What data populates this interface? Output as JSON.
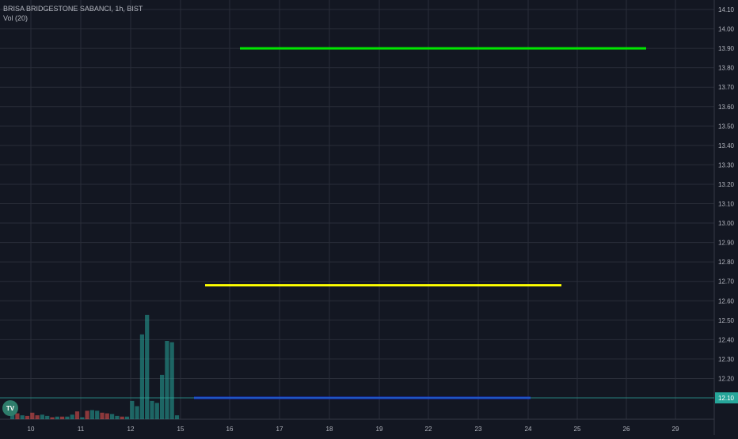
{
  "header": {
    "title": "BRISA BRIDGESTONE SABANCI, 1h, BIST",
    "indicator": "Vol (20)"
  },
  "logo": {
    "text": "TV",
    "color": "#2e7d6b"
  },
  "colors": {
    "background": "#131722",
    "grid": "#2a2e39",
    "axis_text": "#b2b5be",
    "up_volume": "#26a69a",
    "down_volume": "#ef5350",
    "price_marker_bg": "#26a69a",
    "price_marker_line": "#26a69a"
  },
  "chart_data": {
    "type": "bar",
    "x_ticks": [
      "10",
      "11",
      "12",
      "15",
      "16",
      "17",
      "18",
      "19",
      "22",
      "23",
      "24",
      "25",
      "26",
      "29"
    ],
    "y_ticks": [
      "14.10",
      "14.00",
      "13.90",
      "13.80",
      "13.70",
      "13.60",
      "13.50",
      "13.40",
      "13.30",
      "13.20",
      "13.10",
      "13.00",
      "12.90",
      "12.80",
      "12.70",
      "12.60",
      "12.50",
      "12.40",
      "12.30",
      "12.20",
      "12.10"
    ],
    "ylim": [
      12.0,
      14.15
    ],
    "last_price": "12.10",
    "volume_bars": [
      {
        "x": "10",
        "v": 7,
        "dir": "up"
      },
      {
        "x": "10",
        "v": 9,
        "dir": "down"
      },
      {
        "x": "10",
        "v": 6,
        "dir": "up"
      },
      {
        "x": "10",
        "v": 5,
        "dir": "down"
      },
      {
        "x": "10",
        "v": 10,
        "dir": "down"
      },
      {
        "x": "10",
        "v": 6,
        "dir": "down"
      },
      {
        "x": "10",
        "v": 7,
        "dir": "up"
      },
      {
        "x": "10",
        "v": 5,
        "dir": "up"
      },
      {
        "x": "11",
        "v": 3,
        "dir": "down"
      },
      {
        "x": "11",
        "v": 4,
        "dir": "up"
      },
      {
        "x": "11",
        "v": 4,
        "dir": "down"
      },
      {
        "x": "11",
        "v": 4,
        "dir": "up"
      },
      {
        "x": "11",
        "v": 7,
        "dir": "up"
      },
      {
        "x": "11",
        "v": 12,
        "dir": "down"
      },
      {
        "x": "11",
        "v": 3,
        "dir": "up"
      },
      {
        "x": "11",
        "v": 13,
        "dir": "down"
      },
      {
        "x": "11",
        "v": 14,
        "dir": "up"
      },
      {
        "x": "11",
        "v": 13,
        "dir": "up"
      },
      {
        "x": "11",
        "v": 10,
        "dir": "down"
      },
      {
        "x": "11",
        "v": 9,
        "dir": "down"
      },
      {
        "x": "11",
        "v": 8,
        "dir": "up"
      },
      {
        "x": "11",
        "v": 5,
        "dir": "up"
      },
      {
        "x": "12",
        "v": 4,
        "dir": "down"
      },
      {
        "x": "12",
        "v": 4,
        "dir": "up"
      },
      {
        "x": "12",
        "v": 28,
        "dir": "up"
      },
      {
        "x": "12",
        "v": 20,
        "dir": "up"
      },
      {
        "x": "12",
        "v": 130,
        "dir": "up"
      },
      {
        "x": "12",
        "v": 160,
        "dir": "up"
      },
      {
        "x": "12",
        "v": 28,
        "dir": "up"
      },
      {
        "x": "12",
        "v": 25,
        "dir": "up"
      },
      {
        "x": "12",
        "v": 68,
        "dir": "up"
      },
      {
        "x": "12",
        "v": 120,
        "dir": "up"
      },
      {
        "x": "12",
        "v": 118,
        "dir": "up"
      },
      {
        "x": "12",
        "v": 6,
        "dir": "up"
      }
    ],
    "volume_max": 160,
    "horizontal_lines": [
      {
        "name": "green-level-line",
        "color": "#00e600",
        "price": 13.9,
        "from": "16",
        "to": "26"
      },
      {
        "name": "yellow-level-line",
        "color": "#ffff00",
        "price": 12.68,
        "from": "15",
        "to": "24"
      },
      {
        "name": "blue-level-line",
        "color": "#1a2bd6",
        "price": 12.1,
        "from": "15",
        "to": "24"
      }
    ]
  }
}
